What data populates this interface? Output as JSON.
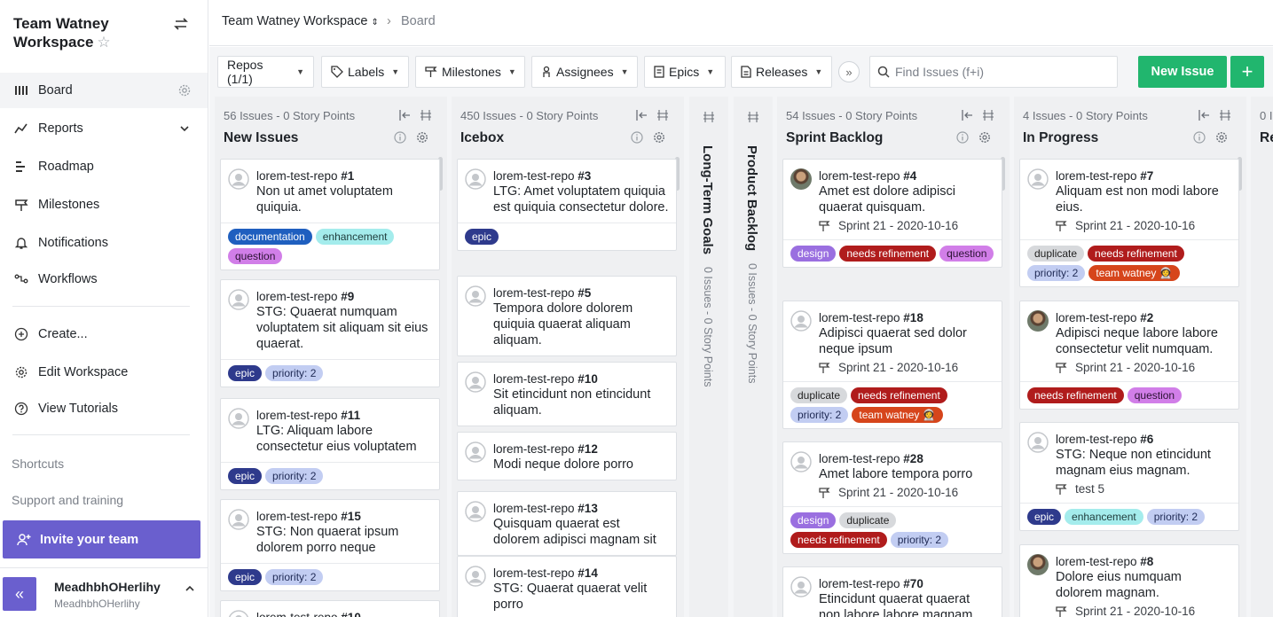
{
  "sidebar": {
    "workspace_title": "Team Watney Workspace",
    "nav": [
      {
        "label": "Board",
        "icon": "board-icon"
      },
      {
        "label": "Reports",
        "icon": "reports-icon"
      },
      {
        "label": "Roadmap",
        "icon": "roadmap-icon"
      },
      {
        "label": "Milestones",
        "icon": "milestone-icon"
      },
      {
        "label": "Notifications",
        "icon": "bell-icon"
      },
      {
        "label": "Workflows",
        "icon": "workflow-icon"
      }
    ],
    "actions": [
      {
        "label": "Create...",
        "icon": "plus-circle-icon"
      },
      {
        "label": "Edit Workspace",
        "icon": "gear-icon"
      },
      {
        "label": "View Tutorials",
        "icon": "help-icon"
      }
    ],
    "shortcuts": "Shortcuts",
    "support": "Support and training",
    "invite": "Invite your team",
    "user_name": "MeadhbhOHerlihy",
    "user_handle": "MeadhbhOHerlihy"
  },
  "breadcrumb": {
    "workspace": "Team Watney Workspace",
    "page": "Board"
  },
  "toolbar": {
    "repos": "Repos (1/1)",
    "labels": "Labels",
    "milestones": "Milestones",
    "assignees": "Assignees",
    "epics": "Epics",
    "releases": "Releases",
    "search_placeholder": "Find Issues (f+i)",
    "new_issue": "New Issue"
  },
  "colors": {
    "accent_purple": "#6a5fce",
    "green": "#21b66e",
    "documentation": "#1f5fbf",
    "enhancement": "#a4ecec",
    "question": "#d17ee8",
    "epic": "#2e3a8c",
    "priority": "#c2cdf2",
    "design": "#9a6fe0",
    "needs_refinement": "#b01c1c",
    "duplicate": "#d7d9dc",
    "team_watney": "#d6451b"
  },
  "columns": [
    {
      "count": "56 Issues",
      "points": "0 Story Points",
      "title": "New Issues",
      "cards": [
        {
          "repo": "lorem-test-repo",
          "num": "#1",
          "title": "Non ut amet voluptatem quiquia.",
          "labels": [
            "documentation",
            "enhancement",
            "question"
          ]
        },
        {
          "repo": "lorem-test-repo",
          "num": "#9",
          "title": "STG: Quaerat numquam voluptatem sit aliquam sit eius quaerat.",
          "labels": [
            "epic",
            "priority: 2"
          ]
        },
        {
          "repo": "lorem-test-repo",
          "num": "#11",
          "title": "LTG: Aliquam labore consectetur eius voluptatem",
          "labels": [
            "epic",
            "priority: 2"
          ]
        },
        {
          "repo": "lorem-test-repo",
          "num": "#15",
          "title": "STG: Non quaerat ipsum dolorem porro neque",
          "labels": [
            "epic",
            "priority: 2"
          ]
        },
        {
          "repo": "lorem-test-repo",
          "num": "#10",
          "title": "",
          "labels": []
        }
      ]
    },
    {
      "count": "450 Issues",
      "points": "0 Story Points",
      "title": "Icebox",
      "cards": [
        {
          "repo": "lorem-test-repo",
          "num": "#3",
          "title": "LTG: Amet voluptatem quiquia est quiquia consectetur dolore.",
          "labels": [
            "epic"
          ]
        },
        {
          "repo": "lorem-test-repo",
          "num": "#5",
          "title": "Tempora dolore dolorem quiquia quaerat aliquam aliquam.",
          "labels": []
        },
        {
          "repo": "lorem-test-repo",
          "num": "#10",
          "title": "Sit etincidunt non etincidunt aliquam.",
          "labels": []
        },
        {
          "repo": "lorem-test-repo",
          "num": "#12",
          "title": "Modi neque dolore porro",
          "labels": []
        },
        {
          "repo": "lorem-test-repo",
          "num": "#13",
          "title": "Quisquam quaerat est dolorem adipisci magnam sit",
          "labels": []
        },
        {
          "repo": "lorem-test-repo",
          "num": "#14",
          "title": "STG: Quaerat quaerat velit porro",
          "labels": []
        }
      ]
    },
    {
      "collapsed": true,
      "title": "Long-Term Goals",
      "stats": "0 Issues - 0 Story Points"
    },
    {
      "collapsed": true,
      "title": "Product Backlog",
      "stats": "0 Issues - 0 Story Points"
    },
    {
      "count": "54 Issues",
      "points": "0 Story Points",
      "title": "Sprint Backlog",
      "cards": [
        {
          "repo": "lorem-test-repo",
          "num": "#4",
          "title": "Amet est dolore adipisci quaerat quisquam.",
          "milestone": "Sprint 21 - 2020-10-16",
          "labels": [
            "design",
            "needs refinement",
            "question"
          ]
        },
        {
          "repo": "lorem-test-repo",
          "num": "#18",
          "title": "Adipisci quaerat sed dolor neque ipsum",
          "milestone": "Sprint 21 - 2020-10-16",
          "labels": [
            "duplicate",
            "needs refinement",
            "priority: 2",
            "team watney 👩‍🚀"
          ]
        },
        {
          "repo": "lorem-test-repo",
          "num": "#28",
          "title": "Amet labore tempora porro",
          "milestone": "Sprint 21 - 2020-10-16",
          "labels": [
            "design",
            "duplicate",
            "needs refinement",
            "priority: 2"
          ]
        },
        {
          "repo": "lorem-test-repo",
          "num": "#70",
          "title": "Etincidunt quaerat quaerat non labore labore magnam",
          "milestone": "",
          "labels": []
        }
      ]
    },
    {
      "count": "4 Issues",
      "points": "0 Story Points",
      "title": "In Progress",
      "cards": [
        {
          "repo": "lorem-test-repo",
          "num": "#7",
          "title": "Aliquam est non modi labore eius.",
          "milestone": "Sprint 21 - 2020-10-16",
          "labels": [
            "duplicate",
            "needs refinement",
            "priority: 2",
            "team watney 👩‍🚀"
          ]
        },
        {
          "repo": "lorem-test-repo",
          "num": "#2",
          "title": "Adipisci neque labore labore consectetur velit numquam.",
          "milestone": "Sprint 21 - 2020-10-16",
          "labels": [
            "needs refinement",
            "question"
          ]
        },
        {
          "repo": "lorem-test-repo",
          "num": "#6",
          "title": "STG: Neque non etincidunt magnam eius magnam.",
          "milestone": "test 5",
          "labels": [
            "epic",
            "enhancement",
            "priority: 2"
          ]
        },
        {
          "repo": "lorem-test-repo",
          "num": "#8",
          "title": "Dolore eius numquam dolorem magnam.",
          "milestone": "Sprint 21 - 2020-10-16",
          "labels": []
        }
      ]
    },
    {
      "count": "0 I",
      "title": "Re"
    }
  ]
}
